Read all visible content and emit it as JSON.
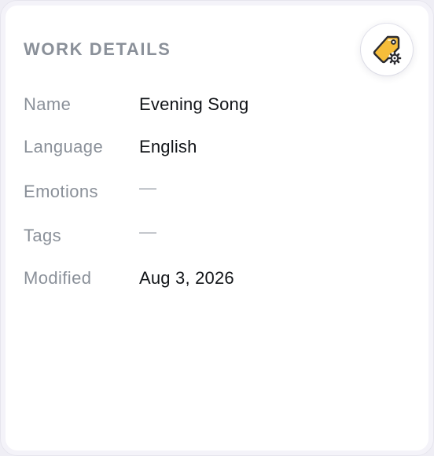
{
  "card": {
    "title": "WORK DETAILS",
    "action_icon": "tag-settings-icon"
  },
  "fields": [
    {
      "label": "Name",
      "value": "Evening Song"
    },
    {
      "label": "Language",
      "value": "English"
    },
    {
      "label": "Emotions",
      "value": "—"
    },
    {
      "label": "Tags",
      "value": "—"
    },
    {
      "label": "Modified",
      "value": "Aug 3, 2026"
    }
  ],
  "colors": {
    "label": "#8a9099",
    "value": "#111418",
    "tag_fill": "#f6bd3a",
    "tag_stroke": "#2b2b30"
  }
}
